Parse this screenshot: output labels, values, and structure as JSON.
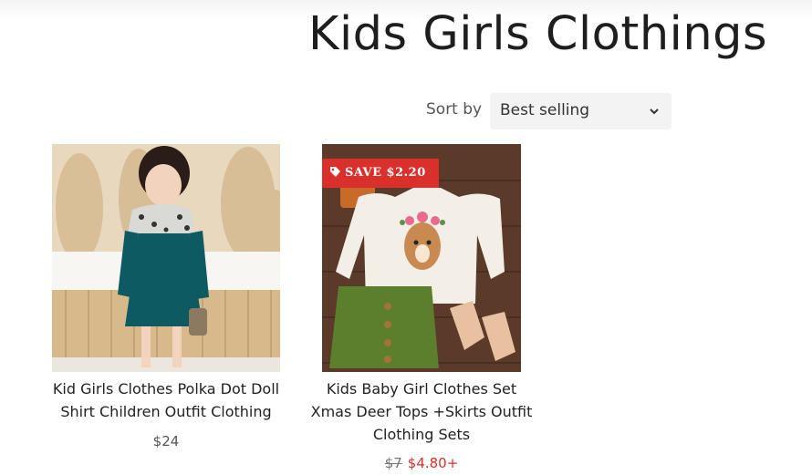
{
  "page": {
    "title": "Kids Girls Clothings"
  },
  "sort": {
    "label": "Sort by",
    "selected": "Best selling"
  },
  "products": [
    {
      "title_line1": "Kid Girls Clothes Polka Dot Doll",
      "title_line2": "Shirt Children Outfit Clothing",
      "price": "$24"
    },
    {
      "title_line1": "Kids Baby Girl Clothes Set",
      "title_line2": "Xmas Deer Tops +Skirts Outfit",
      "title_line3": "Clothing Sets",
      "compare_price": "$7",
      "sale_price": "$4.80+",
      "badge": "SAVE $2.20"
    }
  ],
  "colors": {
    "sale": "#d9302c",
    "select_bg": "#f3f3f3"
  }
}
